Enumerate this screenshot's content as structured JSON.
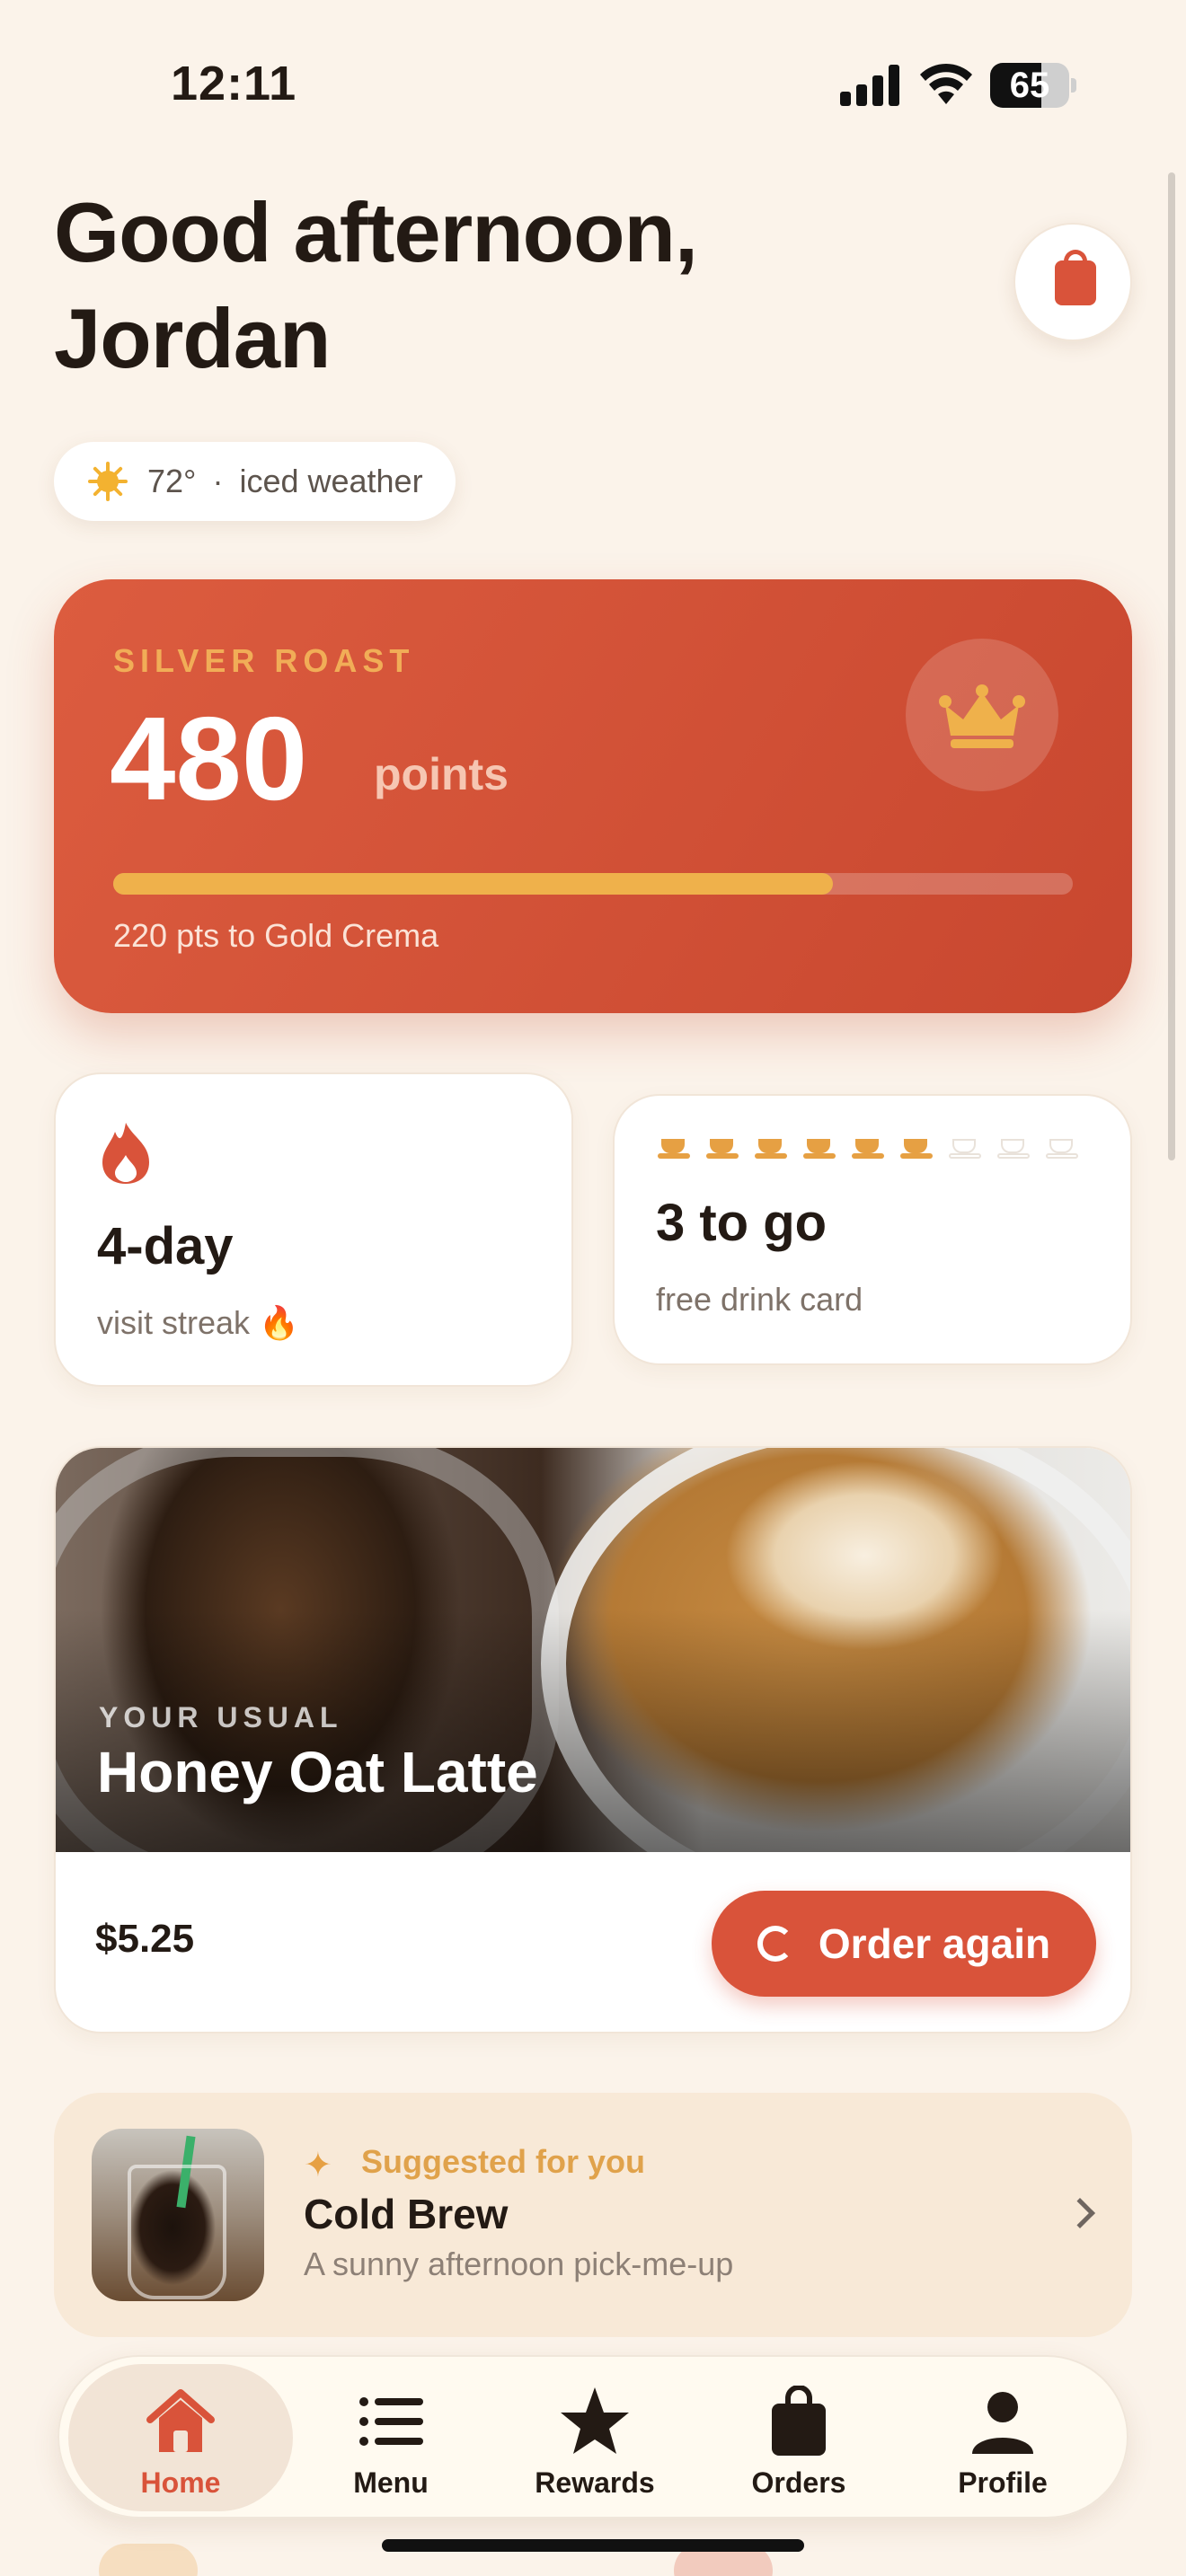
{
  "status_bar": {
    "time": "12:11",
    "battery": "65",
    "battery_level": 0.65
  },
  "header": {
    "greeting_line1": "Good afternoon,",
    "greeting_line2": "Jordan",
    "cart_icon": "shopping-bag-icon"
  },
  "weather": {
    "icon": "sun-icon",
    "temp": "72°",
    "separator": "·",
    "label": "iced weather"
  },
  "points_card": {
    "tier": "SILVER ROAST",
    "points": "480",
    "unit": "points",
    "progress": 0.75,
    "next_tier_text": "220 pts to Gold Crema",
    "accent": "#d9533a"
  },
  "streak": {
    "icon": "flame-icon",
    "value": "4-day",
    "label": "visit streak 🔥"
  },
  "drink_card": {
    "filled": 6,
    "total": 9,
    "value": "3 to go",
    "label": "free drink card"
  },
  "usual": {
    "eyebrow": "YOUR USUAL",
    "name": "Honey Oat Latte",
    "price": "$5.25",
    "order_label": "Order again"
  },
  "suggested": {
    "eyebrow": "Suggested for you",
    "name": "Cold Brew",
    "description": "A sunny afternoon pick-me-up"
  },
  "tabs": [
    {
      "label": "Home",
      "icon": "home-icon",
      "active": true
    },
    {
      "label": "Menu",
      "icon": "list-icon",
      "active": false
    },
    {
      "label": "Rewards",
      "icon": "star-icon",
      "active": false
    },
    {
      "label": "Orders",
      "icon": "bag-icon",
      "active": false
    },
    {
      "label": "Profile",
      "icon": "person-icon",
      "active": false
    }
  ]
}
